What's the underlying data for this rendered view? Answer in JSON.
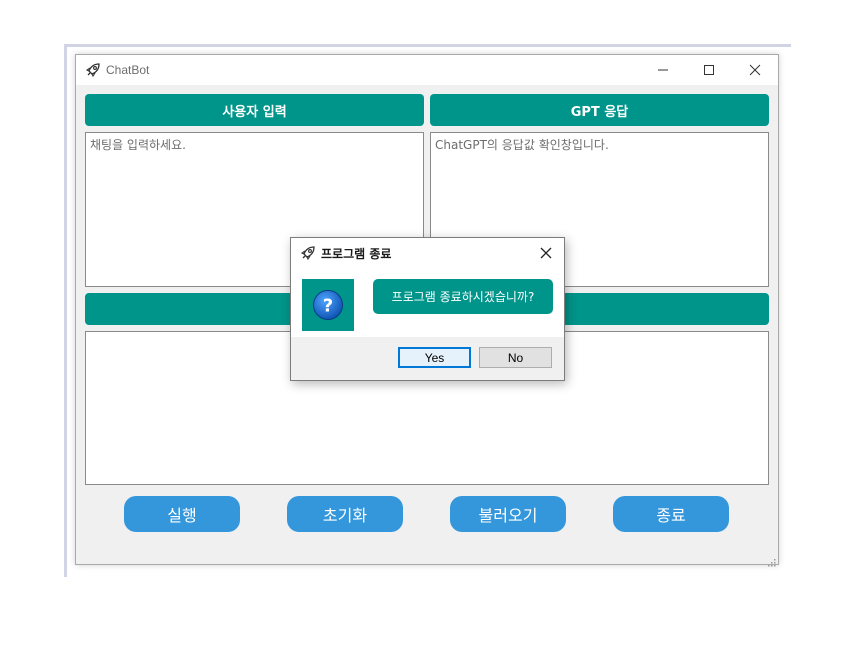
{
  "window": {
    "title": "ChatBot"
  },
  "panels": {
    "user_input_header": "사용자 입력",
    "gpt_response_header": "GPT 응답",
    "user_input_placeholder": "채팅을 입력하세요.",
    "gpt_response_placeholder": "ChatGPT의 응답값 확인창입니다.",
    "history_header": "",
    "history_text": ""
  },
  "buttons": {
    "run": "실행",
    "reset": "초기화",
    "load": "불러오기",
    "exit": "종료"
  },
  "dialog": {
    "title": "프로그램 종료",
    "message": "프로그램 종료하시겠습니까?",
    "yes": "Yes",
    "no": "No"
  },
  "colors": {
    "accent": "#00958a",
    "action": "#3497db"
  },
  "icons": {
    "window": "rocket-icon",
    "dialog_question": "question-icon"
  }
}
